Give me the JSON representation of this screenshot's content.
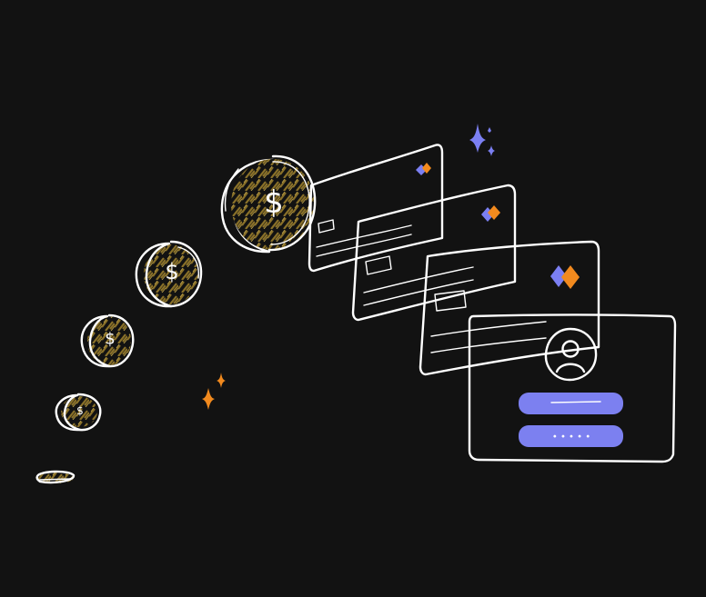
{
  "colors": {
    "background": "#121212",
    "line": "#ffffff",
    "gold": "#8a7129",
    "gold_light": "#b59a45",
    "accent_blue": "#7b7ff2",
    "accent_orange": "#f28a1e",
    "login_field": "#7c80f0"
  },
  "coins": [
    {
      "glyph": "$"
    },
    {
      "glyph": "$"
    },
    {
      "glyph": "$"
    },
    {
      "glyph": "$"
    },
    {
      "glyph": ""
    }
  ],
  "login_panel": {
    "avatar_icon": "user-icon",
    "password_mask": "• • • • •"
  },
  "icons": [
    "sparkle-icon",
    "user-icon",
    "brand-diamonds-icon",
    "dollar-coin-icon"
  ]
}
